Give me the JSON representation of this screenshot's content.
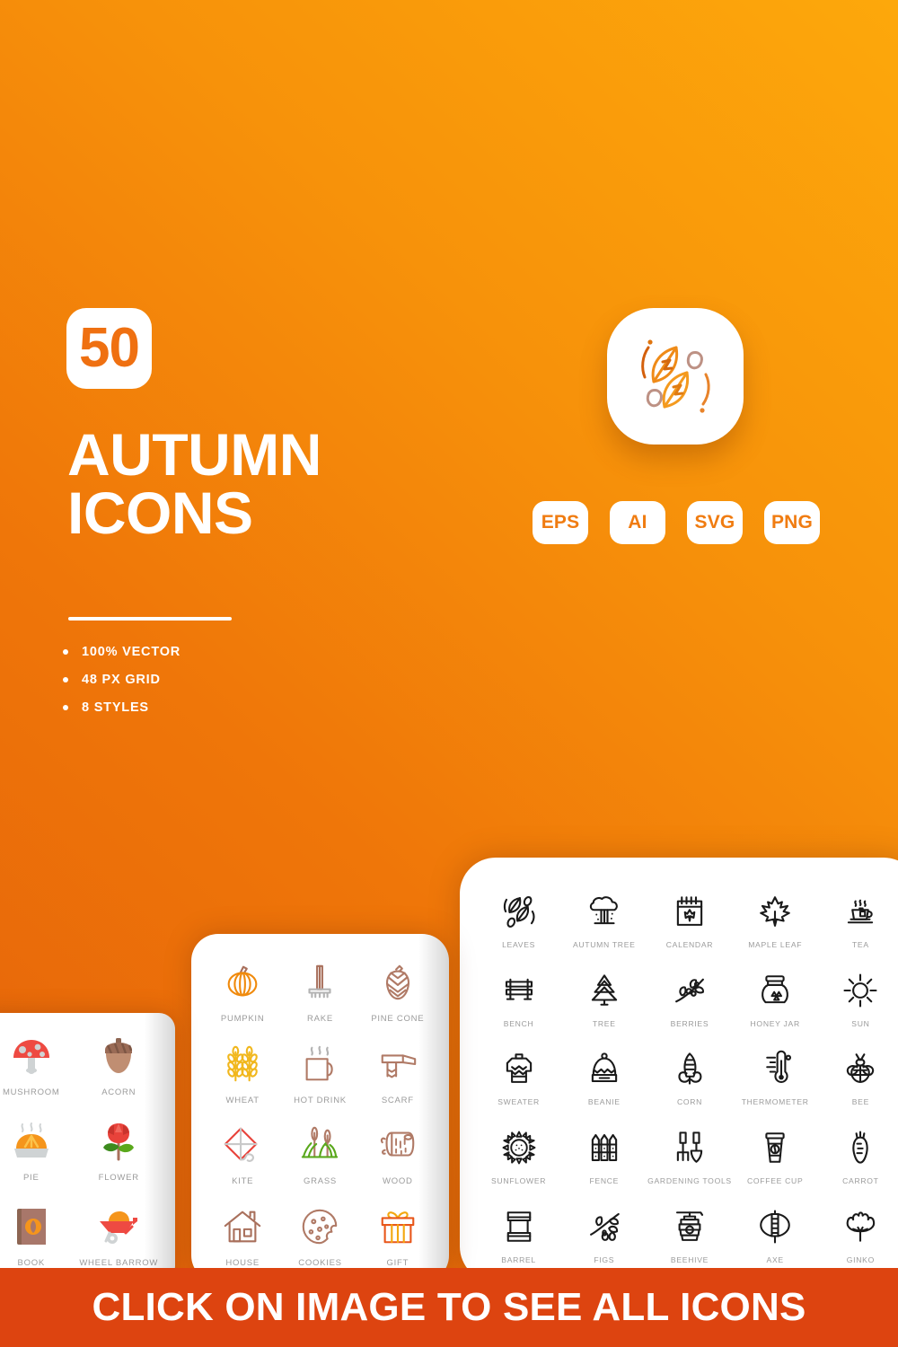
{
  "hero": {
    "count": "50",
    "title_line1": "AUTUMN",
    "title_line2": "ICONS",
    "features": [
      "100% VECTOR",
      "48 PX GRID",
      "8 STYLES"
    ],
    "formats": [
      "EPS",
      "AI",
      "SVG",
      "PNG"
    ],
    "logo_icon": "two-leaves-icon"
  },
  "colors": {
    "bg_gradient_start": "#e4610a",
    "bg_gradient_end": "#fda80b",
    "accent_orange": "#ef7011",
    "cta_banner": "#dd4410",
    "card_white": "#ffffff",
    "caption_gray": "#9b9b9b",
    "icon_black": "#1a1a1a"
  },
  "cards": {
    "flat_card": {
      "style": "flat-color",
      "columns": 2,
      "items": [
        {
          "label": "MUSHROOM",
          "icon": "mushroom-icon"
        },
        {
          "label": "ACORN",
          "icon": "acorn-icon"
        },
        {
          "label": "PIE",
          "icon": "pie-icon"
        },
        {
          "label": "FLOWER",
          "icon": "flower-icon"
        },
        {
          "label": "BOOK",
          "icon": "book-icon"
        },
        {
          "label": "WHEEL BARROW",
          "icon": "wheelbarrow-icon"
        }
      ]
    },
    "colored_outline_card": {
      "style": "colored-outline",
      "columns": 3,
      "items": [
        {
          "label": "PUMPKIN",
          "icon": "pumpkin-icon"
        },
        {
          "label": "RAKE",
          "icon": "rake-icon"
        },
        {
          "label": "PINE CONE",
          "icon": "pine-cone-icon"
        },
        {
          "label": "WHEAT",
          "icon": "wheat-icon"
        },
        {
          "label": "HOT DRINK",
          "icon": "hot-drink-icon"
        },
        {
          "label": "SCARF",
          "icon": "scarf-icon"
        },
        {
          "label": "KITE",
          "icon": "kite-icon"
        },
        {
          "label": "GRASS",
          "icon": "grass-icon"
        },
        {
          "label": "WOOD",
          "icon": "wood-icon"
        },
        {
          "label": "HOUSE",
          "icon": "house-icon"
        },
        {
          "label": "COOKIES",
          "icon": "cookies-icon"
        },
        {
          "label": "GIFT",
          "icon": "gift-icon"
        }
      ]
    },
    "line_card": {
      "style": "black-line",
      "columns": 5,
      "items": [
        {
          "label": "LEAVES",
          "icon": "leaves-icon"
        },
        {
          "label": "AUTUMN TREE",
          "icon": "autumn-tree-icon"
        },
        {
          "label": "CALENDAR",
          "icon": "calendar-icon"
        },
        {
          "label": "MAPLE LEAF",
          "icon": "maple-leaf-icon"
        },
        {
          "label": "TEA",
          "icon": "tea-icon"
        },
        {
          "label": "BENCH",
          "icon": "bench-icon"
        },
        {
          "label": "TREE",
          "icon": "tree-icon"
        },
        {
          "label": "BERRIES",
          "icon": "berries-icon"
        },
        {
          "label": "HONEY JAR",
          "icon": "honey-jar-icon"
        },
        {
          "label": "SUN",
          "icon": "sun-icon"
        },
        {
          "label": "SWEATER",
          "icon": "sweater-icon"
        },
        {
          "label": "BEANIE",
          "icon": "beanie-icon"
        },
        {
          "label": "CORN",
          "icon": "corn-icon"
        },
        {
          "label": "THERMOMETER",
          "icon": "thermometer-icon"
        },
        {
          "label": "BEE",
          "icon": "bee-icon"
        },
        {
          "label": "SUNFLOWER",
          "icon": "sunflower-icon"
        },
        {
          "label": "FENCE",
          "icon": "fence-icon"
        },
        {
          "label": "GARDENING TOOLS",
          "icon": "gardening-tools-icon"
        },
        {
          "label": "COFFEE CUP",
          "icon": "coffee-cup-icon"
        },
        {
          "label": "CARROT",
          "icon": "carrot-icon"
        },
        {
          "label": "BARREL",
          "icon": "barrel-icon"
        },
        {
          "label": "FIGS",
          "icon": "figs-icon"
        },
        {
          "label": "BEEHIVE",
          "icon": "beehive-icon"
        },
        {
          "label": "AXE",
          "icon": "axe-icon"
        },
        {
          "label": "GINKO",
          "icon": "ginko-icon"
        }
      ]
    }
  },
  "cta": {
    "text": "CLICK ON IMAGE TO SEE ALL ICONS"
  }
}
